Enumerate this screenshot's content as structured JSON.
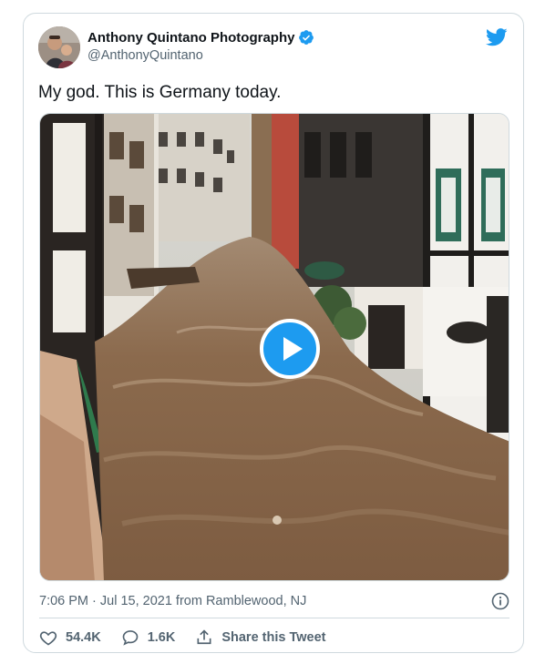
{
  "tweet": {
    "author_name": "Anthony Quintano Photography",
    "handle": "@AnthonyQuintano",
    "text": "My god. This is Germany today.",
    "timestamp": "7:06 PM · Jul 15, 2021 from Ramblewood, NJ",
    "likes": "54.4K",
    "replies": "1.6K",
    "share_label": "Share this Tweet"
  },
  "icons": {
    "brand": "twitter-bird-icon",
    "verified": "verified-badge-icon",
    "info": "info-icon",
    "like": "heart-icon",
    "reply": "reply-bubble-icon",
    "share": "share-upload-icon",
    "play": "play-icon"
  },
  "colors": {
    "brand_blue": "#1d9bf0",
    "text_secondary": "#536471",
    "flood_water": "#8b6a4d"
  }
}
